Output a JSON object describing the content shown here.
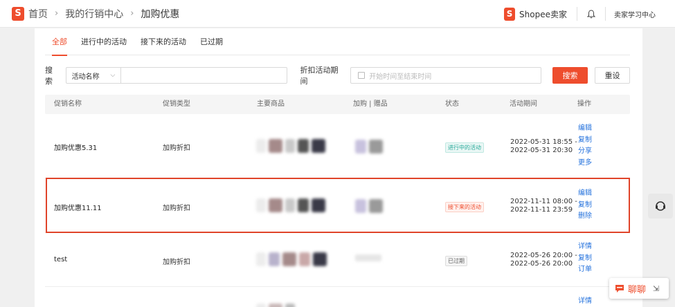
{
  "header": {
    "logo_letter": "S",
    "breadcrumb": [
      "首页",
      "我的行销中心",
      "加购优惠"
    ],
    "shop_logo_letter": "S",
    "shop_name": "Shopee卖家",
    "learning_center": "卖家学习中心"
  },
  "tabs": [
    "全部",
    "进行中的活动",
    "接下来的活动",
    "已过期"
  ],
  "active_tab": "全部",
  "search": {
    "label": "搜索",
    "field_select": "活动名称",
    "name_value": "",
    "date_label": "折扣活动期间",
    "date_placeholder": "开始时间至结束时间",
    "search_button": "搜索",
    "reset_button": "重设"
  },
  "table": {
    "columns": [
      "促销名称",
      "促销类型",
      "主要商品",
      "加购 | 赠品",
      "状态",
      "活动期间",
      "操作"
    ],
    "rows": [
      {
        "name": "加购优惠5.31",
        "type": "加购折扣",
        "status": "进行中的活动",
        "status_kind": "ongoing",
        "start": "2022-05-31 18:55 -",
        "end": "2022-05-31 20:30",
        "actions": [
          "编辑",
          "复制",
          "分享",
          "更多"
        ]
      },
      {
        "name": "加购优惠11.11",
        "type": "加购折扣",
        "status": "接下来的活动",
        "status_kind": "upcoming",
        "start": "2022-11-11 08:00 -",
        "end": "2022-11-11 23:59",
        "actions": [
          "编辑",
          "复制",
          "删除"
        ]
      },
      {
        "name": "test",
        "type": "加购折扣",
        "status": "已过期",
        "status_kind": "expired",
        "start": "2022-05-26 20:00 -",
        "end": "2022-05-26 20:00",
        "actions": [
          "详情",
          "复制",
          "订单"
        ]
      },
      {
        "actions": [
          "详情"
        ]
      }
    ]
  },
  "chat": {
    "label": "聊聊"
  },
  "colors": {
    "accent": "#ee4d2d",
    "link": "#2673dd",
    "highlight_border": "#e0442a"
  }
}
